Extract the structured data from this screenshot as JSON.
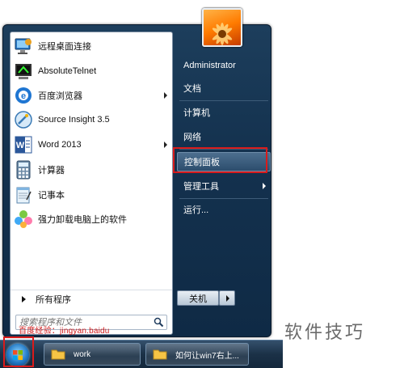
{
  "start_menu": {
    "programs": [
      {
        "label": "远程桌面连接",
        "icon": "remote-desktop-icon",
        "has_submenu": false
      },
      {
        "label": "AbsoluteTelnet",
        "icon": "telnet-icon",
        "has_submenu": false
      },
      {
        "label": "百度浏览器",
        "icon": "baidu-browser-icon",
        "has_submenu": true
      },
      {
        "label": "Source Insight 3.5",
        "icon": "source-insight-icon",
        "has_submenu": false
      },
      {
        "label": "Word 2013",
        "icon": "word-icon",
        "has_submenu": true
      },
      {
        "label": "计算器",
        "icon": "calculator-icon",
        "has_submenu": false
      },
      {
        "label": "记事本",
        "icon": "notepad-icon",
        "has_submenu": false
      },
      {
        "label": "强力卸载电脑上的软件",
        "icon": "uninstaller-icon",
        "has_submenu": false
      }
    ],
    "all_programs_label": "所有程序",
    "search_placeholder": "搜索程序和文件",
    "watermark_text": "百度经验：jingyan.baidu",
    "right_items": [
      {
        "label": "Administrator",
        "has_submenu": false
      },
      {
        "label": "文档",
        "has_submenu": false
      },
      {
        "label": "计算机",
        "has_submenu": false
      },
      {
        "label": "网络",
        "has_submenu": false
      },
      {
        "label": "控制面板",
        "has_submenu": false,
        "highlighted": true
      },
      {
        "label": "管理工具",
        "has_submenu": true
      },
      {
        "label": "运行...",
        "has_submenu": false
      }
    ],
    "shutdown_label": "关机"
  },
  "taskbar": {
    "items": [
      {
        "label": "work",
        "icon": "folder-icon"
      },
      {
        "label": "如何让win7右上...",
        "icon": "folder-icon"
      }
    ]
  },
  "brand_watermark": "软件技巧",
  "colors": {
    "highlight_border": "#d91b1b",
    "menu_background": "#14324f",
    "taskbar_background": "#1b3147"
  }
}
